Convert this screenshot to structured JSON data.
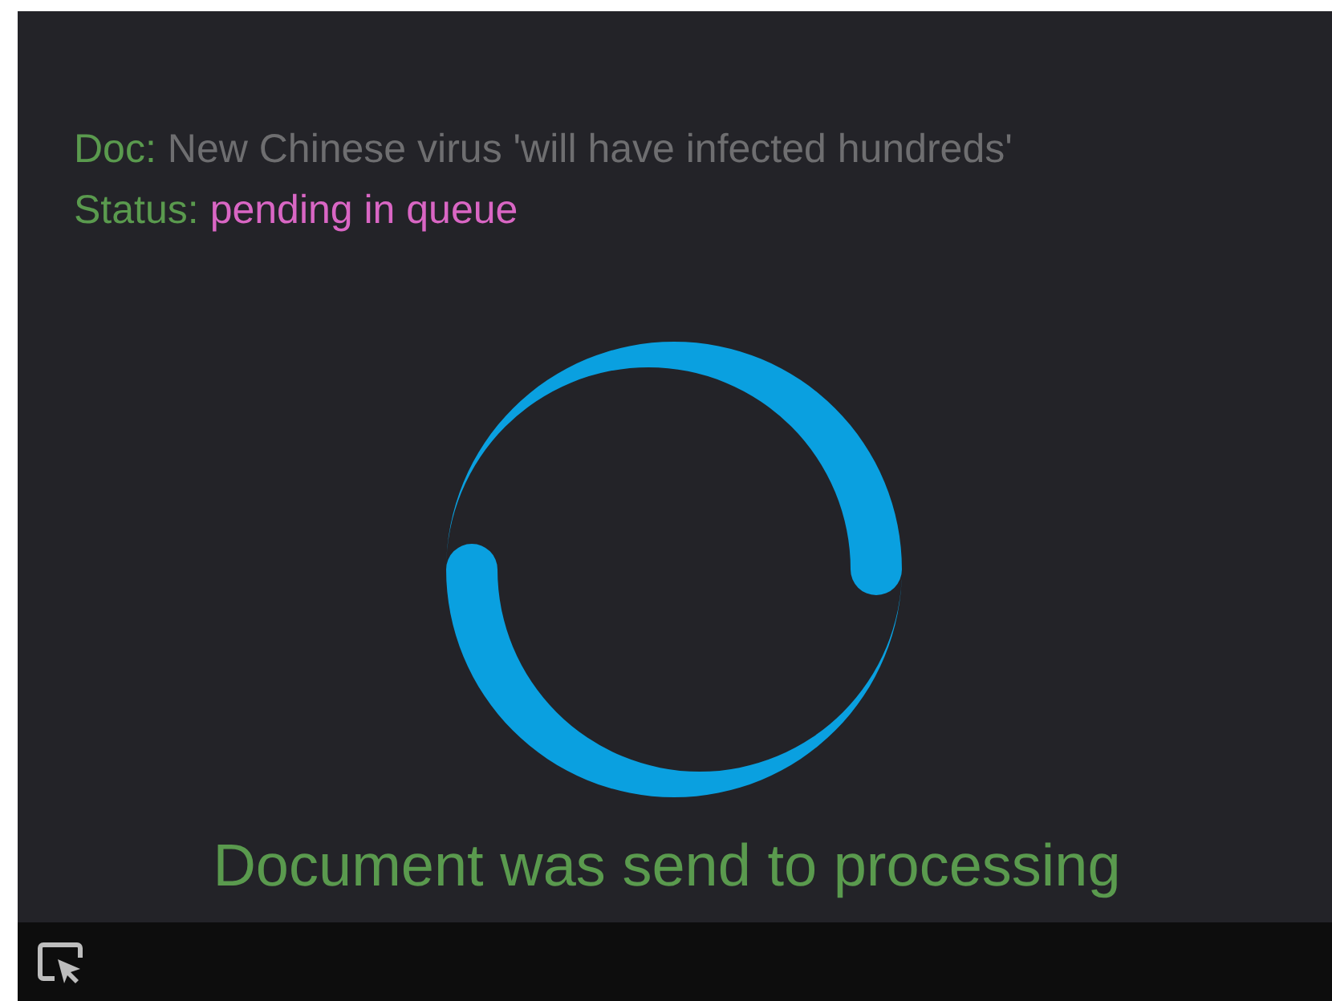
{
  "document": {
    "label": "Doc:",
    "title": "New Chinese virus 'will have infected hundreds'"
  },
  "status": {
    "label": "Status:",
    "value": "pending in queue"
  },
  "message": "Document was send to processing"
}
